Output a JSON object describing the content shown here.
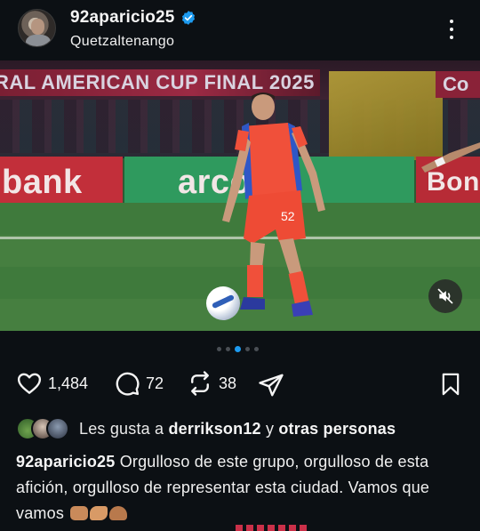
{
  "post": {
    "username": "92aparicio25",
    "location": "Quetzaltenango",
    "verified": true,
    "icons": {
      "avatar": "avatar",
      "verified": "verified-badge-icon",
      "more": "more-vertical-icon"
    }
  },
  "photo": {
    "banner_text": "RAL AMERICAN CUP FINAL 2025",
    "banner_right_text": "Co",
    "ad_left": "bank",
    "ad_middle": "arcolo",
    "ad_right": "Bon",
    "jersey_number": "52",
    "carousel": {
      "count": 5,
      "active": 3
    },
    "mute_icon": "speaker-muted-icon"
  },
  "actions": {
    "likes": "1,484",
    "comments": "72",
    "reposts": "38",
    "icons": [
      "heart-icon",
      "comment-icon",
      "repost-icon",
      "share-icon",
      "bookmark-icon"
    ]
  },
  "liked_by": {
    "prefix": "Les gusta a",
    "user": "derrikson12",
    "connector": "y",
    "others": "otras personas"
  },
  "caption": {
    "username": "92aparicio25",
    "text": "Orgulloso de este grupo, orgulloso de esta afición, orgulloso de representar esta ciudad. Vamos que vamos"
  }
}
